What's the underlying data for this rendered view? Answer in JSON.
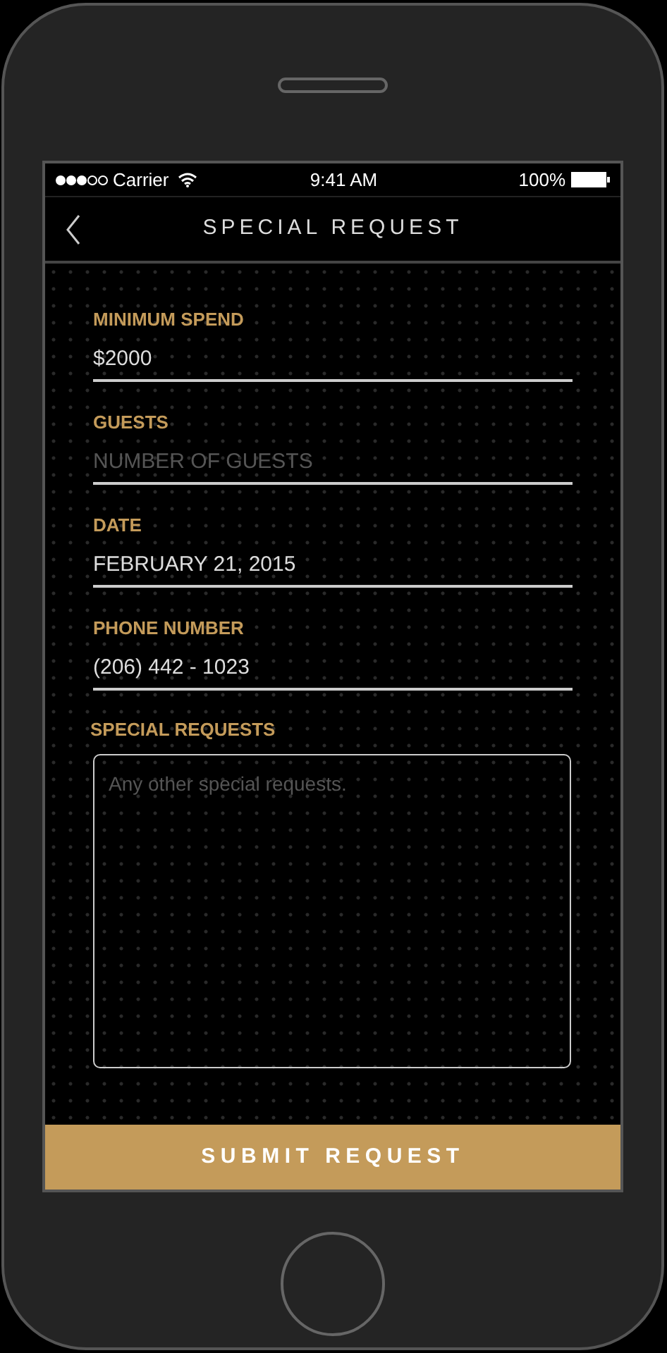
{
  "status_bar": {
    "carrier": "Carrier",
    "time": "9:41 AM",
    "battery": "100%"
  },
  "nav": {
    "title": "SPECIAL REQUEST"
  },
  "fields": [
    {
      "label": "MINIMUM SPEND",
      "value": "$2000"
    },
    {
      "label": "GUESTS",
      "placeholder": "NUMBER OF GUESTS"
    },
    {
      "label": "DATE",
      "value": "FEBRUARY 21, 2015"
    },
    {
      "label": "PHONE NUMBER",
      "value": "(206) 442 - 1023"
    }
  ],
  "special_requests": {
    "label": "SPECIAL REQUESTS",
    "placeholder": "Any other special requests."
  },
  "submit": "SUBMIT REQUEST"
}
